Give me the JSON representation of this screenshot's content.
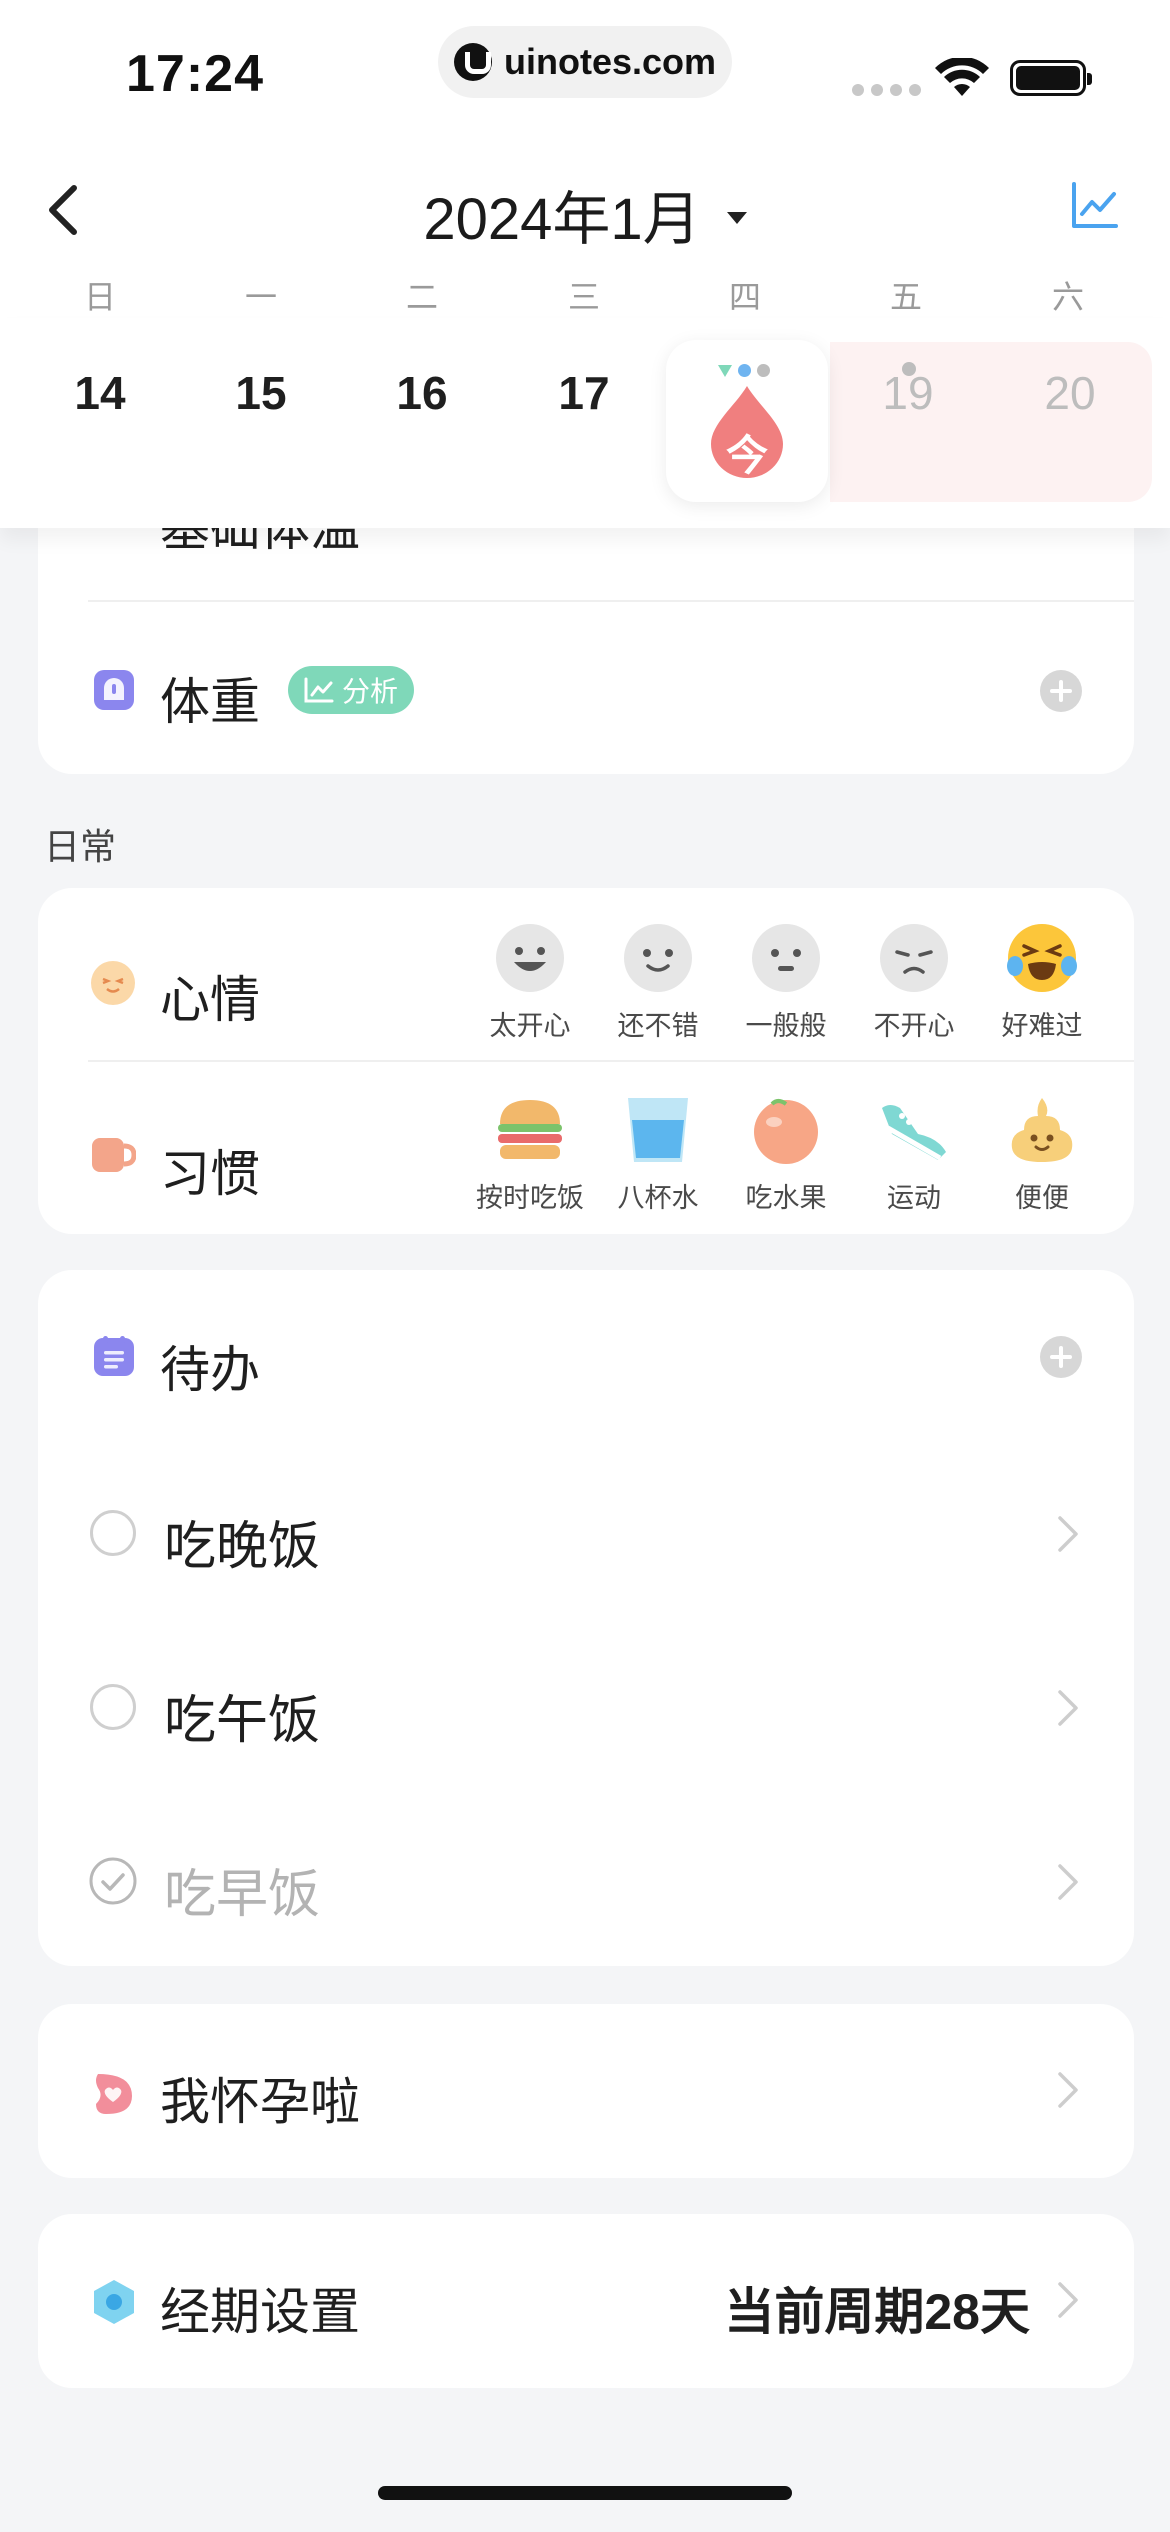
{
  "status_bar": {
    "time": "17:24",
    "url": "uinotes.com"
  },
  "header": {
    "title": "2024年1月",
    "weekdays": [
      "日",
      "一",
      "二",
      "三",
      "四",
      "五",
      "六"
    ]
  },
  "dates": {
    "cells": [
      "14",
      "15",
      "16",
      "17",
      "19",
      "20"
    ],
    "today_label": "今"
  },
  "body": {
    "partial_row_label": "基础体温",
    "weight": {
      "label": "体重",
      "badge": "分析"
    },
    "section_daily": "日常",
    "mood": {
      "label": "心情",
      "options": [
        "太开心",
        "还不错",
        "一般般",
        "不开心",
        "好难过"
      ]
    },
    "habit": {
      "label": "习惯",
      "options": [
        "按时吃饭",
        "八杯水",
        "吃水果",
        "运动",
        "便便"
      ]
    },
    "todo": {
      "label": "待办",
      "items": [
        {
          "label": "吃晚饭",
          "done": false
        },
        {
          "label": "吃午饭",
          "done": false
        },
        {
          "label": "吃早饭",
          "done": true
        }
      ]
    },
    "pregnant": {
      "label": "我怀孕啦"
    },
    "period": {
      "label": "经期设置",
      "value": "当前周期28天"
    }
  },
  "colors": {
    "accent_red": "#f07f7f",
    "badge_green": "#7fd8b9",
    "chart_blue": "#4aa3ef",
    "icon_purple": "#8b86ee"
  }
}
